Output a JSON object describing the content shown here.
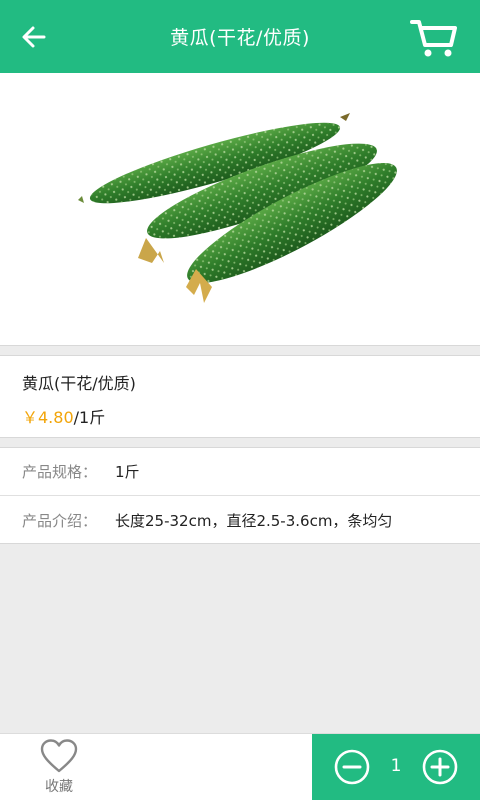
{
  "header": {
    "title": "黄瓜(干花/优质)",
    "back_icon": "arrow-left-icon",
    "cart_icon": "shopping-cart-icon",
    "background_color": "#22bb82"
  },
  "product": {
    "image_icon": "cucumber-image",
    "name": "黄瓜(干花/优质)",
    "price": "￥4.80",
    "unit": "/1斤",
    "price_color": "#f2a50a"
  },
  "specs": [
    {
      "key": "产品规格：",
      "value": "1斤"
    },
    {
      "key": "产品介绍：",
      "value": "长度25-32cm，直径2.5-3.6cm，条均匀"
    }
  ],
  "bottom": {
    "favorite_label": "收藏",
    "favorite_icon": "heart-icon",
    "quantity": "1",
    "minus_icon": "minus-circle-icon",
    "plus_icon": "plus-circle-icon"
  }
}
